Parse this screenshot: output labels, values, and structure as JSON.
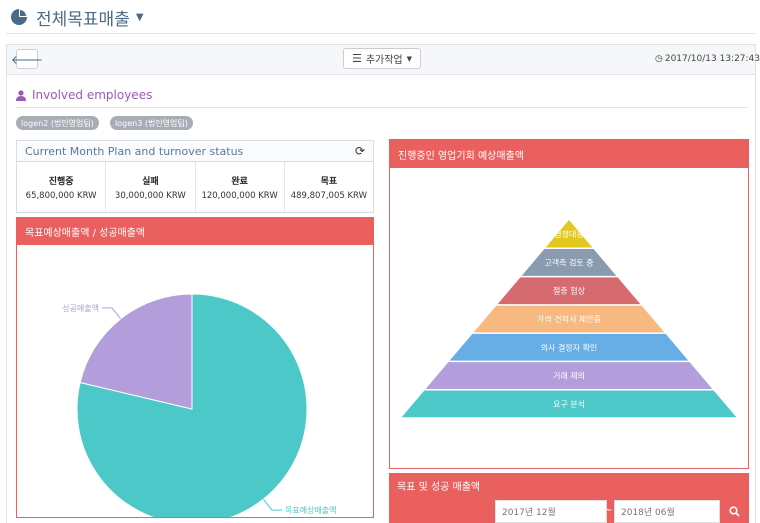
{
  "page": {
    "title": "전체목표매출"
  },
  "toolbar": {
    "add_work_label": "추가작업",
    "datetime": "2017/10/13 13:27:43"
  },
  "involved": {
    "label": "Involved employees",
    "tags": [
      "logen2 (법인영업팀)",
      "logen3 (법인영업팀)"
    ]
  },
  "status": {
    "title": "Current Month Plan and turnover status",
    "items": [
      {
        "label": "진행중",
        "value": "65,800,000 KRW"
      },
      {
        "label": "실패",
        "value": "30,000,000 KRW"
      },
      {
        "label": "완료",
        "value": "120,000,000 KRW"
      },
      {
        "label": "목표",
        "value": "489,807,005 KRW"
      }
    ]
  },
  "pie_card": {
    "title": "목표예상매출액 / 성공매출액"
  },
  "pyramid_card": {
    "title": "진행중인 영업기회 예상매출액"
  },
  "range_card": {
    "title": "목표 및 성공 매출액",
    "from": "2017년 12월",
    "sep": "~",
    "to": "2018년 06월"
  },
  "colors": {
    "accent_red": "#e9605e",
    "teal": "#4dc8c9",
    "lavender": "#b39ddb"
  },
  "chart_data": [
    {
      "type": "pie",
      "labels": [
        "목표예상매출액",
        "성공매출액"
      ],
      "values": [
        78.7,
        21.3
      ],
      "colors": [
        "#4dc8c9",
        "#b39ddb"
      ]
    },
    {
      "type": "funnel",
      "levels": [
        "경쟁대응",
        "고객측 검토 중",
        "절충 협상",
        "가격 견적서 제안중",
        "의사 결정자 확인",
        "거래 제의",
        "요구 분석"
      ],
      "colors": [
        "#e2c71f",
        "#8a9bb0",
        "#d66b6f",
        "#f7b97f",
        "#67aee6",
        "#b39ddb",
        "#4dc8c9"
      ]
    }
  ]
}
